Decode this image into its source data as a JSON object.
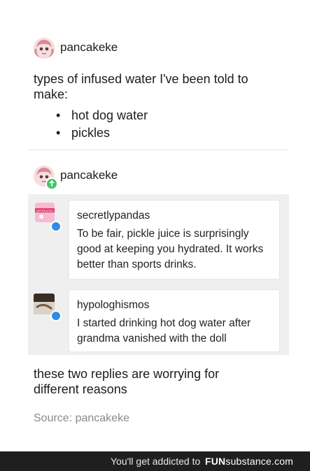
{
  "post": {
    "username": "pancakeke",
    "text": "types of infused water I've been told to make:",
    "list": [
      "hot dog water",
      "pickles"
    ]
  },
  "reblog": {
    "username": "pancakeke",
    "replies": [
      {
        "username": "secretlypandas",
        "text": "To be fair, pickle juice is surprisingly good at keeping you hydrated. It works better than sports drinks."
      },
      {
        "username": "hypologhismos",
        "text": "I started drinking hot dog water after grandma vanished with the doll"
      }
    ],
    "comment": "these two replies are worrying for different reasons",
    "source": "Source: pancakeke"
  },
  "footer": {
    "tagline": "You'll get addicted to",
    "brand_fun": "FUN",
    "brand_sub": "substance",
    "brand_tld": ".com"
  },
  "colors": {
    "reply_icon": "#2f8de4",
    "footer_bg": "#1f1f1f",
    "source_text": "#8a8a8a"
  }
}
